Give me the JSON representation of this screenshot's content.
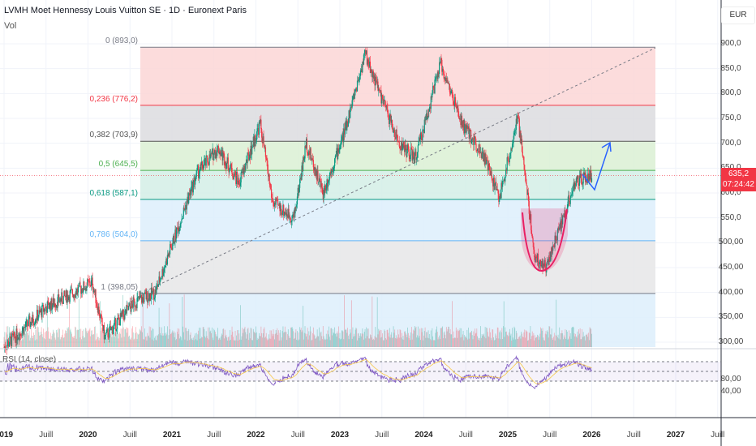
{
  "header": {
    "title": "LVMH Moet Hennessy Louis Vuitton SE · 1D · Euronext Paris",
    "volume_label": "Vol",
    "currency": "EUR"
  },
  "indicator": {
    "rsi_label": "RSI (14, close)",
    "rsi_ticks": [
      "80,00",
      "40,00"
    ]
  },
  "current_price": {
    "value": "635,2",
    "countdown": "07:24:42",
    "color": "#f23645"
  },
  "chart_data": {
    "type": "candlestick",
    "title": "LVMH Moet Hennessy Louis Vuitton SE · 1D · Euronext Paris",
    "price_ticks": [
      "900,0",
      "850,0",
      "800,0",
      "750,0",
      "700,0",
      "650,0",
      "600,0",
      "550,0",
      "500,00",
      "450,00",
      "400,00",
      "350,00",
      "300,00"
    ],
    "ylim": [
      292,
      935
    ],
    "date_ticks": [
      {
        "label": "2019",
        "year": true
      },
      {
        "label": "Juill"
      },
      {
        "label": "2020",
        "year": true
      },
      {
        "label": "Juill"
      },
      {
        "label": "2021",
        "year": true
      },
      {
        "label": "Juill"
      },
      {
        "label": "2022",
        "year": true
      },
      {
        "label": "Juill"
      },
      {
        "label": "2023",
        "year": true
      },
      {
        "label": "Juill"
      },
      {
        "label": "2024",
        "year": true
      },
      {
        "label": "Juill"
      },
      {
        "label": "2025",
        "year": true
      },
      {
        "label": "Juill"
      },
      {
        "label": "2026",
        "year": true
      },
      {
        "label": "Juill"
      },
      {
        "label": "2027",
        "year": true
      },
      {
        "label": "Juill"
      }
    ],
    "price_path": [
      [
        2019.0,
        290
      ],
      [
        2019.5,
        370
      ],
      [
        2020.05,
        420
      ],
      [
        2020.2,
        310
      ],
      [
        2020.55,
        380
      ],
      [
        2020.8,
        400
      ],
      [
        2021.05,
        520
      ],
      [
        2021.3,
        640
      ],
      [
        2021.55,
        690
      ],
      [
        2021.8,
        620
      ],
      [
        2022.05,
        740
      ],
      [
        2022.2,
        580
      ],
      [
        2022.45,
        550
      ],
      [
        2022.6,
        700
      ],
      [
        2022.8,
        600
      ],
      [
        2023.05,
        720
      ],
      [
        2023.3,
        880
      ],
      [
        2023.5,
        790
      ],
      [
        2023.7,
        700
      ],
      [
        2023.9,
        670
      ],
      [
        2024.2,
        860
      ],
      [
        2024.45,
        740
      ],
      [
        2024.7,
        680
      ],
      [
        2024.9,
        590
      ],
      [
        2025.05,
        700
      ],
      [
        2025.12,
        750
      ],
      [
        2025.22,
        620
      ],
      [
        2025.32,
        470
      ],
      [
        2025.45,
        450
      ],
      [
        2025.6,
        520
      ],
      [
        2025.8,
        620
      ],
      [
        2026.0,
        635.2
      ]
    ],
    "fibonacci": [
      {
        "label": "0 (893,0)",
        "level": 893.0,
        "color": "#787b86",
        "fill": "#fbd6d6"
      },
      {
        "label": "0,236 (776,2)",
        "level": 776.2,
        "color": "#f23645",
        "fill": "#dcdcdf"
      },
      {
        "label": "0,382 (703,9)",
        "level": 703.9,
        "color": "#555555",
        "fill": "#daf0d4"
      },
      {
        "label": "0,5 (645,5)",
        "level": 645.5,
        "color": "#4caf50",
        "fill": "#d4eee6"
      },
      {
        "label": "0,618 (587,1)",
        "level": 587.1,
        "color": "#089981",
        "fill": "#ddeefc"
      },
      {
        "label": "0,786 (504,0)",
        "level": 504.0,
        "color": "#64b5f6",
        "fill": "#e6e6e8"
      },
      {
        "label": "1 (398,05)",
        "level": 398.05,
        "color": "#787b86",
        "fill": "#ddeefc"
      }
    ],
    "rsi_levels": [
      70,
      50,
      30
    ],
    "colors": {
      "up": "#089981",
      "down": "#f23645",
      "rsi": "#7e57c2",
      "rsi_ma": "#f7c948",
      "projection": "#2962ff",
      "cup": "#e91e63"
    }
  }
}
